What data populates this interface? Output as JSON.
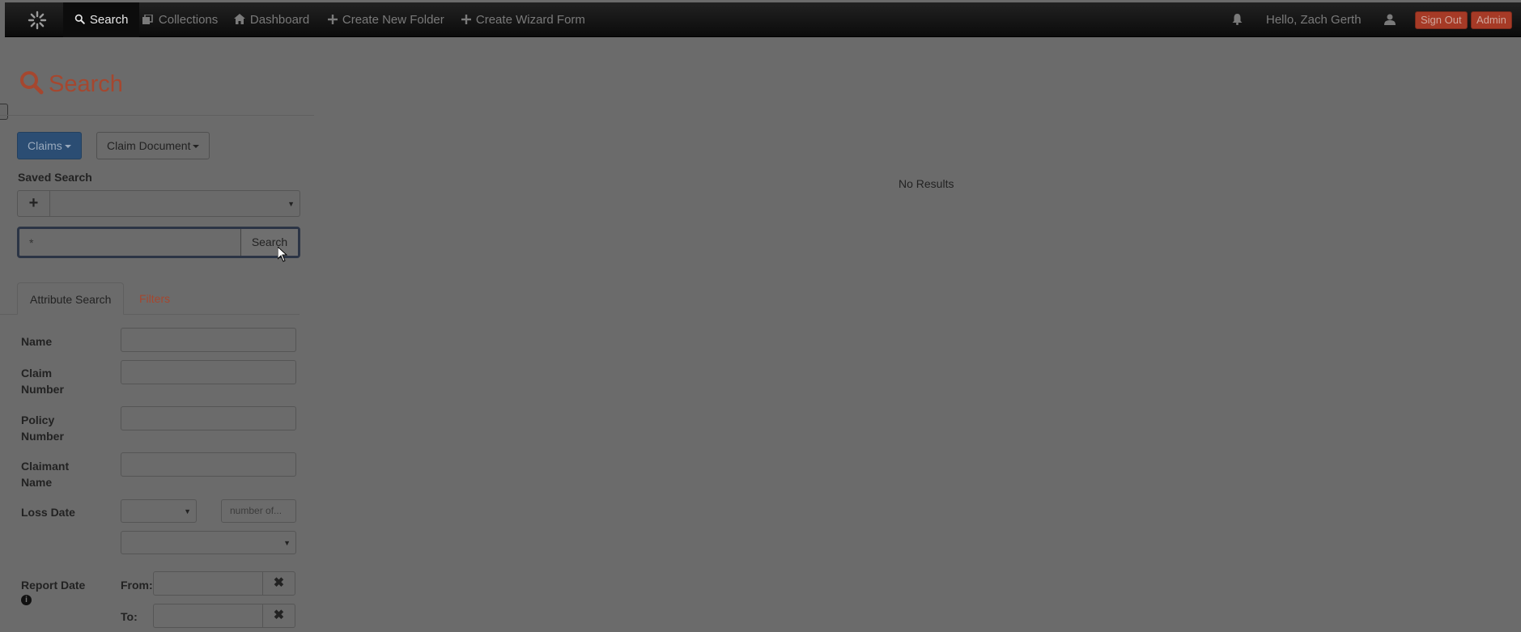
{
  "nav": {
    "search": "Search",
    "collections": "Collections",
    "dashboard": "Dashboard",
    "create_folder": "Create New Folder",
    "create_wizard": "Create Wizard Form",
    "greeting": "Hello, Zach Gerth",
    "sign_out": "Sign Out",
    "admin": "Admin"
  },
  "page": {
    "title": "Search"
  },
  "type_selectors": {
    "primary": "Claims",
    "secondary": "Claim Document"
  },
  "saved_search": {
    "label": "Saved Search",
    "add_glyph": "+",
    "value": ""
  },
  "search": {
    "value": "*",
    "button": "Search"
  },
  "tabs": {
    "attribute": "Attribute Search",
    "filters": "Filters"
  },
  "fields": {
    "name": "Name",
    "claim_number_1": "Claim",
    "claim_number_2": "Number",
    "policy_number_1": "Policy",
    "policy_number_2": "Number",
    "claimant_name_1": "Claimant",
    "claimant_name_2": "Name",
    "loss_date": "Loss Date",
    "loss_date_number_placeholder": "number of...",
    "report_date": "Report Date",
    "from": "From:",
    "to": "To:",
    "clear_glyph": "✖"
  },
  "results": {
    "empty_text": "No Results"
  },
  "colors": {
    "accent": "#a5472f",
    "primary_button": "#2b4d73",
    "navbar": "#111111",
    "overlay_background": "#6b6b6b"
  }
}
